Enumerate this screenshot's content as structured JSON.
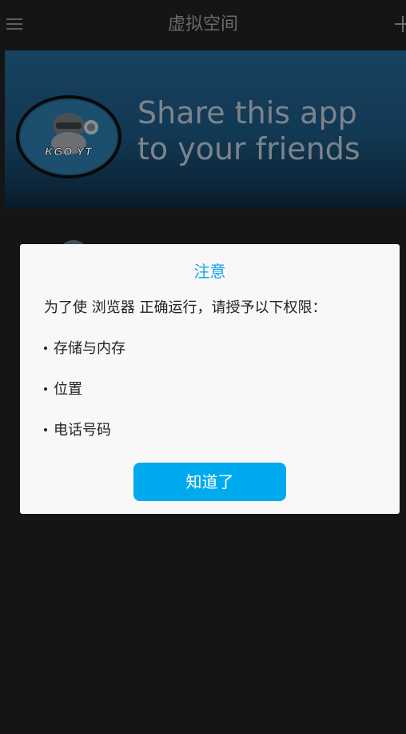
{
  "app_bar": {
    "title": "虚拟空间",
    "menu_icon": "hamburger-menu-icon",
    "add_icon": "plus-icon"
  },
  "banner": {
    "headline": "Share this app\nto your friends",
    "logo_text": "KGO YT"
  },
  "dialog": {
    "title": "注意",
    "message": "为了使 浏览器 正确运行，请授予以下权限：",
    "permissions": [
      "存储与内存",
      "位置",
      "电话号码"
    ],
    "confirm_label": "知道了"
  },
  "colors": {
    "accent": "#00aaee",
    "title_blue": "#1aa3e6",
    "background": "#181818",
    "dialog_bg": "#f8f8f8"
  }
}
